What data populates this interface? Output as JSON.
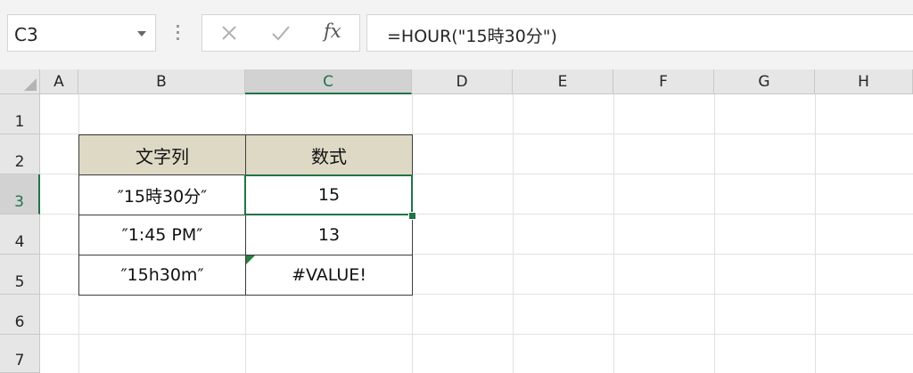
{
  "name_box": {
    "value": "C3"
  },
  "formula_bar": {
    "cancel_glyph": "✕",
    "enter_glyph": "✓",
    "fx_label": "fx",
    "formula": "=HOUR(\"15時30分\")"
  },
  "columns": [
    "A",
    "B",
    "C",
    "D",
    "E",
    "F",
    "G",
    "H"
  ],
  "rows": [
    "1",
    "2",
    "3",
    "4",
    "5",
    "6",
    "7"
  ],
  "selected": {
    "cell": "C3",
    "column": "C",
    "row": "3"
  },
  "table": {
    "headers": [
      "文字列",
      "数式"
    ],
    "rows": [
      [
        "″15時30分″",
        "15"
      ],
      [
        "″1:45 PM″",
        "13"
      ],
      [
        "″15h30m″",
        "#VALUE!"
      ]
    ]
  },
  "colors": {
    "selection_green": "#217346",
    "header_fill": "#ddd9c4",
    "error_indicator": "#2a7d3c"
  }
}
